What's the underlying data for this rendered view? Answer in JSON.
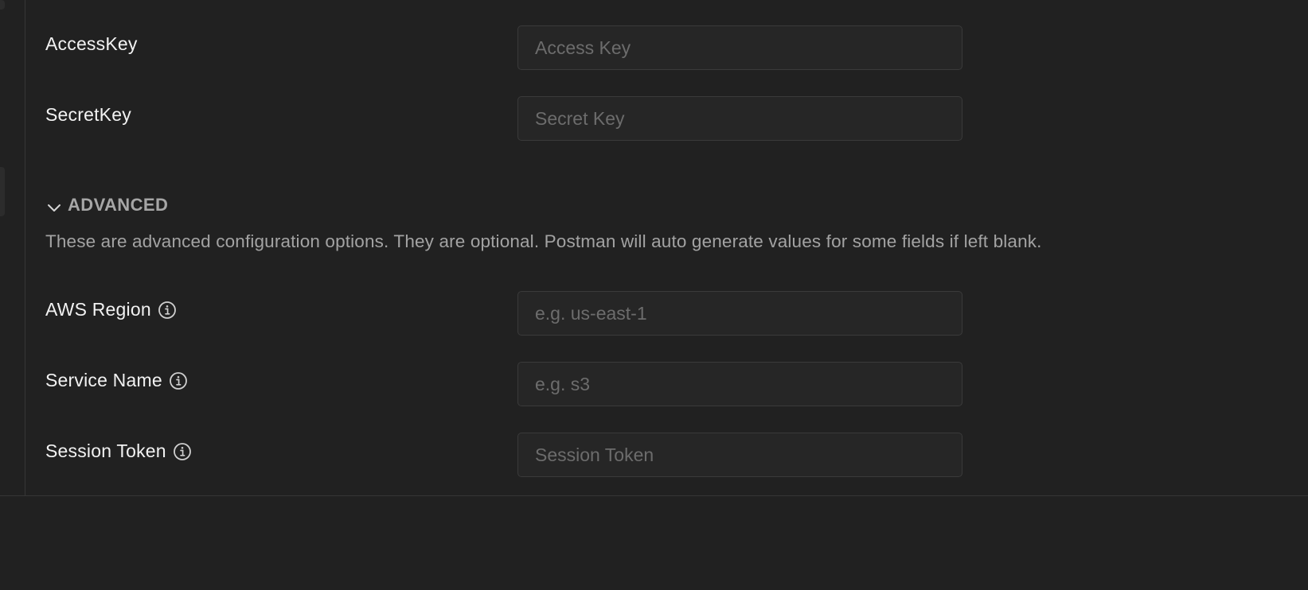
{
  "auth": {
    "fields": [
      {
        "label": "AccessKey",
        "placeholder": "Access Key",
        "value": ""
      },
      {
        "label": "SecretKey",
        "placeholder": "Secret Key",
        "value": ""
      }
    ]
  },
  "advanced": {
    "title": "ADVANCED",
    "expanded": true,
    "description": "These are advanced configuration options. They are optional. Postman will auto generate values for some fields if left blank.",
    "fields": [
      {
        "label": "AWS Region",
        "placeholder": "e.g. us-east-1",
        "value": "",
        "icon": "info-icon"
      },
      {
        "label": "Service Name",
        "placeholder": "e.g. s3",
        "value": "",
        "icon": "info-icon"
      },
      {
        "label": "Session Token",
        "placeholder": "Session Token",
        "value": "",
        "icon": "info-icon"
      }
    ]
  },
  "colors": {
    "background": "#212121",
    "input_background": "#262626",
    "input_border": "#3a3a3a",
    "label_text": "#f2f2f2",
    "muted_text": "#a3a3a3",
    "placeholder_text": "#6c6c6c",
    "divider": "#363636"
  }
}
